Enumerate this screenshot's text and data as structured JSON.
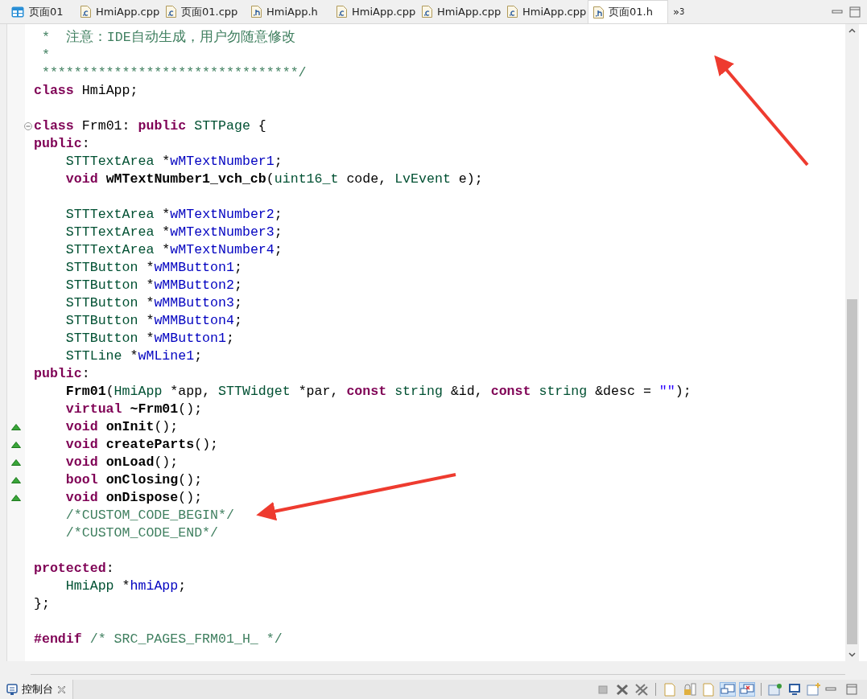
{
  "tabs": [
    {
      "kind": "page",
      "label": "页面01",
      "selected": false
    },
    {
      "kind": "cpp",
      "label": "HmiApp.cpp",
      "selected": false
    },
    {
      "kind": "cpp",
      "label": "页面01.cpp",
      "selected": false
    },
    {
      "kind": "h",
      "label": "HmiApp.h",
      "selected": false
    },
    {
      "kind": "cpp",
      "label": "HmiApp.cpp",
      "selected": false
    },
    {
      "kind": "cpp",
      "label": "HmiApp.cpp",
      "selected": false
    },
    {
      "kind": "cpp",
      "label": "HmiApp.cpp",
      "selected": false
    },
    {
      "kind": "h",
      "label": "页面01.h",
      "selected": true
    }
  ],
  "tab_overflow": {
    "chevron": "»",
    "count": "3"
  },
  "code_lines": [
    {
      "kind": "code",
      "tokens": [
        {
          "kind": "comment",
          "t": " *  注意：IDE自动生成，用户勿随意修改"
        }
      ]
    },
    {
      "kind": "code",
      "tokens": [
        {
          "kind": "comment",
          "t": " *"
        }
      ]
    },
    {
      "kind": "code",
      "tokens": [
        {
          "kind": "comment",
          "t": " ********************************/"
        }
      ]
    },
    {
      "kind": "code",
      "tokens": [
        {
          "kind": "kw",
          "t": "class"
        },
        {
          "kind": "plain",
          "t": " HmiApp;"
        }
      ]
    },
    {
      "kind": "blank"
    },
    {
      "kind": "fold",
      "tokens": [
        {
          "kind": "kw",
          "t": "class"
        },
        {
          "kind": "plain",
          "t": " Frm01: "
        },
        {
          "kind": "kw",
          "t": "public"
        },
        {
          "kind": "type",
          "t": " STTPage"
        },
        {
          "kind": "plain",
          "t": " {"
        }
      ]
    },
    {
      "kind": "code",
      "tokens": [
        {
          "kind": "kw",
          "t": "public"
        },
        {
          "kind": "plain",
          "t": ":"
        }
      ]
    },
    {
      "kind": "code",
      "tokens": [
        {
          "kind": "type",
          "t": "    STTTextArea"
        },
        {
          "kind": "plain",
          "t": " *"
        },
        {
          "kind": "field",
          "t": "wMTextNumber1"
        },
        {
          "kind": "plain",
          "t": ";"
        }
      ]
    },
    {
      "kind": "code",
      "tokens": [
        {
          "kind": "kw",
          "t": "    void"
        },
        {
          "kind": "fn",
          "t": " wMTextNumber1_vch_cb"
        },
        {
          "kind": "plain",
          "t": "("
        },
        {
          "kind": "type",
          "t": "uint16_t"
        },
        {
          "kind": "plain",
          "t": " code, "
        },
        {
          "kind": "type",
          "t": "LvEvent"
        },
        {
          "kind": "plain",
          "t": " e);"
        }
      ]
    },
    {
      "kind": "blank"
    },
    {
      "kind": "code",
      "tokens": [
        {
          "kind": "type",
          "t": "    STTTextArea"
        },
        {
          "kind": "plain",
          "t": " *"
        },
        {
          "kind": "field",
          "t": "wMTextNumber2"
        },
        {
          "kind": "plain",
          "t": ";"
        }
      ]
    },
    {
      "kind": "code",
      "tokens": [
        {
          "kind": "type",
          "t": "    STTTextArea"
        },
        {
          "kind": "plain",
          "t": " *"
        },
        {
          "kind": "field",
          "t": "wMTextNumber3"
        },
        {
          "kind": "plain",
          "t": ";"
        }
      ]
    },
    {
      "kind": "code",
      "tokens": [
        {
          "kind": "type",
          "t": "    STTTextArea"
        },
        {
          "kind": "plain",
          "t": " *"
        },
        {
          "kind": "field",
          "t": "wMTextNumber4"
        },
        {
          "kind": "plain",
          "t": ";"
        }
      ]
    },
    {
      "kind": "code",
      "tokens": [
        {
          "kind": "type",
          "t": "    STTButton"
        },
        {
          "kind": "plain",
          "t": " *"
        },
        {
          "kind": "field",
          "t": "wMMButton1"
        },
        {
          "kind": "plain",
          "t": ";"
        }
      ]
    },
    {
      "kind": "code",
      "tokens": [
        {
          "kind": "type",
          "t": "    STTButton"
        },
        {
          "kind": "plain",
          "t": " *"
        },
        {
          "kind": "field",
          "t": "wMMButton2"
        },
        {
          "kind": "plain",
          "t": ";"
        }
      ]
    },
    {
      "kind": "code",
      "tokens": [
        {
          "kind": "type",
          "t": "    STTButton"
        },
        {
          "kind": "plain",
          "t": " *"
        },
        {
          "kind": "field",
          "t": "wMMButton3"
        },
        {
          "kind": "plain",
          "t": ";"
        }
      ]
    },
    {
      "kind": "code",
      "tokens": [
        {
          "kind": "type",
          "t": "    STTButton"
        },
        {
          "kind": "plain",
          "t": " *"
        },
        {
          "kind": "field",
          "t": "wMMButton4"
        },
        {
          "kind": "plain",
          "t": ";"
        }
      ]
    },
    {
      "kind": "code",
      "tokens": [
        {
          "kind": "type",
          "t": "    STTButton"
        },
        {
          "kind": "plain",
          "t": " *"
        },
        {
          "kind": "field",
          "t": "wMButton1"
        },
        {
          "kind": "plain",
          "t": ";"
        }
      ]
    },
    {
      "kind": "code",
      "tokens": [
        {
          "kind": "type",
          "t": "    STTLine"
        },
        {
          "kind": "plain",
          "t": " *"
        },
        {
          "kind": "field",
          "t": "wMLine1"
        },
        {
          "kind": "plain",
          "t": ";"
        }
      ]
    },
    {
      "kind": "code",
      "tokens": [
        {
          "kind": "kw",
          "t": "public"
        },
        {
          "kind": "plain",
          "t": ":"
        }
      ]
    },
    {
      "kind": "code",
      "tokens": [
        {
          "kind": "fn",
          "t": "    Frm01"
        },
        {
          "kind": "plain",
          "t": "("
        },
        {
          "kind": "type",
          "t": "HmiApp"
        },
        {
          "kind": "plain",
          "t": " *app, "
        },
        {
          "kind": "type",
          "t": "STTWidget"
        },
        {
          "kind": "plain",
          "t": " *par, "
        },
        {
          "kind": "kw",
          "t": "const"
        },
        {
          "kind": "type",
          "t": " string"
        },
        {
          "kind": "plain",
          "t": " &id, "
        },
        {
          "kind": "kw",
          "t": "const"
        },
        {
          "kind": "type",
          "t": " string"
        },
        {
          "kind": "plain",
          "t": " &desc = "
        },
        {
          "kind": "string",
          "t": "\"\""
        },
        {
          "kind": "plain",
          "t": ");"
        }
      ]
    },
    {
      "kind": "code",
      "tokens": [
        {
          "kind": "kw",
          "t": "    virtual"
        },
        {
          "kind": "fn",
          "t": " ~Frm01"
        },
        {
          "kind": "plain",
          "t": "();"
        }
      ]
    },
    {
      "kind": "override",
      "tokens": [
        {
          "kind": "kw",
          "t": "    void"
        },
        {
          "kind": "fn",
          "t": " onInit"
        },
        {
          "kind": "plain",
          "t": "();"
        }
      ]
    },
    {
      "kind": "override",
      "tokens": [
        {
          "kind": "kw",
          "t": "    void"
        },
        {
          "kind": "fn",
          "t": " createParts"
        },
        {
          "kind": "plain",
          "t": "();"
        }
      ]
    },
    {
      "kind": "override",
      "tokens": [
        {
          "kind": "kw",
          "t": "    void"
        },
        {
          "kind": "fn",
          "t": " onLoad"
        },
        {
          "kind": "plain",
          "t": "();"
        }
      ]
    },
    {
      "kind": "override",
      "tokens": [
        {
          "kind": "kw",
          "t": "    bool"
        },
        {
          "kind": "fn",
          "t": " onClosing"
        },
        {
          "kind": "plain",
          "t": "();"
        }
      ]
    },
    {
      "kind": "override",
      "tokens": [
        {
          "kind": "kw",
          "t": "    void"
        },
        {
          "kind": "fn",
          "t": " onDispose"
        },
        {
          "kind": "plain",
          "t": "();"
        }
      ]
    },
    {
      "kind": "code",
      "tokens": [
        {
          "kind": "comment",
          "t": "    /*CUSTOM_CODE_BEGIN*/"
        }
      ]
    },
    {
      "kind": "code",
      "tokens": [
        {
          "kind": "comment",
          "t": "    /*CUSTOM_CODE_END*/"
        }
      ]
    },
    {
      "kind": "blank"
    },
    {
      "kind": "code",
      "tokens": [
        {
          "kind": "kw",
          "t": "protected"
        },
        {
          "kind": "plain",
          "t": ":"
        }
      ]
    },
    {
      "kind": "code",
      "tokens": [
        {
          "kind": "type",
          "t": "    HmiApp"
        },
        {
          "kind": "plain",
          "t": " *"
        },
        {
          "kind": "field",
          "t": "hmiApp"
        },
        {
          "kind": "plain",
          "t": ";"
        }
      ]
    },
    {
      "kind": "code",
      "tokens": [
        {
          "kind": "plain",
          "t": "};"
        }
      ]
    },
    {
      "kind": "blank"
    },
    {
      "kind": "code",
      "tokens": [
        {
          "kind": "kw",
          "t": "#endif"
        },
        {
          "kind": "comment",
          "t": " /* SRC_PAGES_FRM01_H_ */"
        }
      ]
    }
  ],
  "console_tab": {
    "label": "控制台"
  },
  "toolbar": [
    {
      "kind": "stop",
      "pressed": false
    },
    {
      "kind": "remove",
      "pressed": false
    },
    {
      "kind": "remove-all",
      "pressed": false
    },
    {
      "kind": "sep"
    },
    {
      "kind": "clear",
      "pressed": false
    },
    {
      "kind": "scroll-lock",
      "pressed": false
    },
    {
      "kind": "word-wrap",
      "pressed": false
    },
    {
      "kind": "show-out",
      "pressed": true
    },
    {
      "kind": "show-err",
      "pressed": true
    },
    {
      "kind": "sep"
    },
    {
      "kind": "pin",
      "pressed": false
    },
    {
      "kind": "display",
      "pressed": false
    },
    {
      "kind": "new-console",
      "pressed": false
    }
  ]
}
